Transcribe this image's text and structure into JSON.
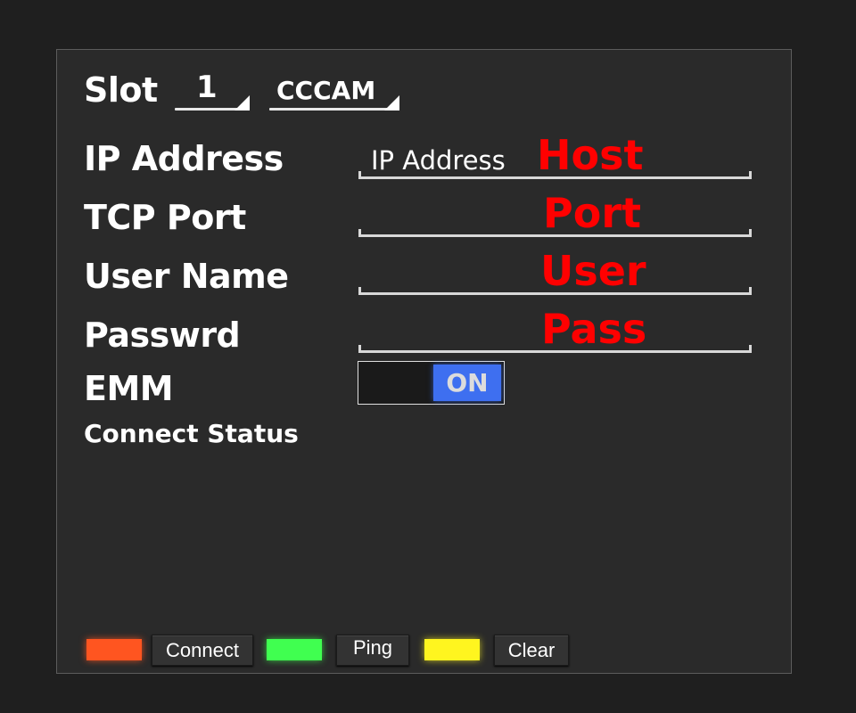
{
  "header": {
    "slot_label": "Slot",
    "slot_value": "1",
    "protocol_value": "CCCAM"
  },
  "fields": [
    {
      "label": "IP Address",
      "placeholder": "IP Address",
      "value": "Host"
    },
    {
      "label": "TCP Port",
      "placeholder": "",
      "value": "Port"
    },
    {
      "label": "User Name",
      "placeholder": "",
      "value": "User"
    },
    {
      "label": "Passwrd",
      "placeholder": "",
      "value": "Pass"
    }
  ],
  "emm": {
    "label": "EMM",
    "toggle_state": "ON"
  },
  "status": {
    "label": "Connect Status"
  },
  "footer": {
    "indicators": [
      {
        "name": "connect-indicator",
        "color": "#ff5520"
      },
      {
        "name": "ping-indicator",
        "color": "#40ff50"
      },
      {
        "name": "clear-indicator",
        "color": "#fff51f"
      }
    ],
    "connect_label": "Connect",
    "ping_label": "Ping",
    "clear_label": "Clear"
  }
}
